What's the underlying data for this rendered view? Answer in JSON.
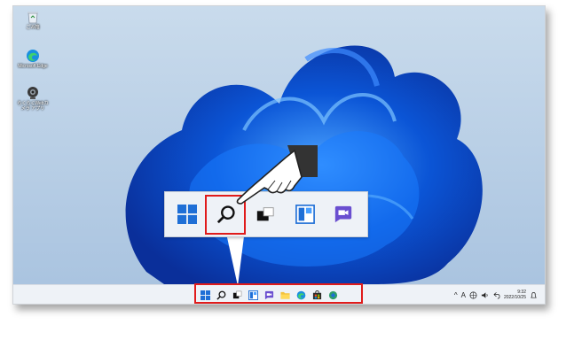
{
  "desktop": {
    "icons": [
      {
        "label": "ごみ箱",
        "icon": "recycle-bin-icon"
      },
      {
        "label": "Microsoft Edge",
        "icon": "edge-icon"
      },
      {
        "label": "らくらくWebカメラ アプリ",
        "icon": "webcam-app-icon"
      }
    ]
  },
  "taskbar": {
    "apps": [
      "start-icon",
      "search-icon",
      "task-view-icon",
      "widgets-icon",
      "chat-icon",
      "file-explorer-icon",
      "edge-icon",
      "store-icon",
      "app-icon"
    ],
    "tray": {
      "chevron": "^",
      "ime": "A",
      "time": "9:32",
      "date": "2022/10/25"
    }
  },
  "zoom_callout": {
    "icons": [
      "start-icon",
      "search-icon",
      "task-view-icon",
      "widgets-icon",
      "chat-icon"
    ]
  },
  "colors": {
    "highlight": "#e01b1b",
    "accent": "#1f6fd6",
    "chat": "#6a4fd0"
  }
}
